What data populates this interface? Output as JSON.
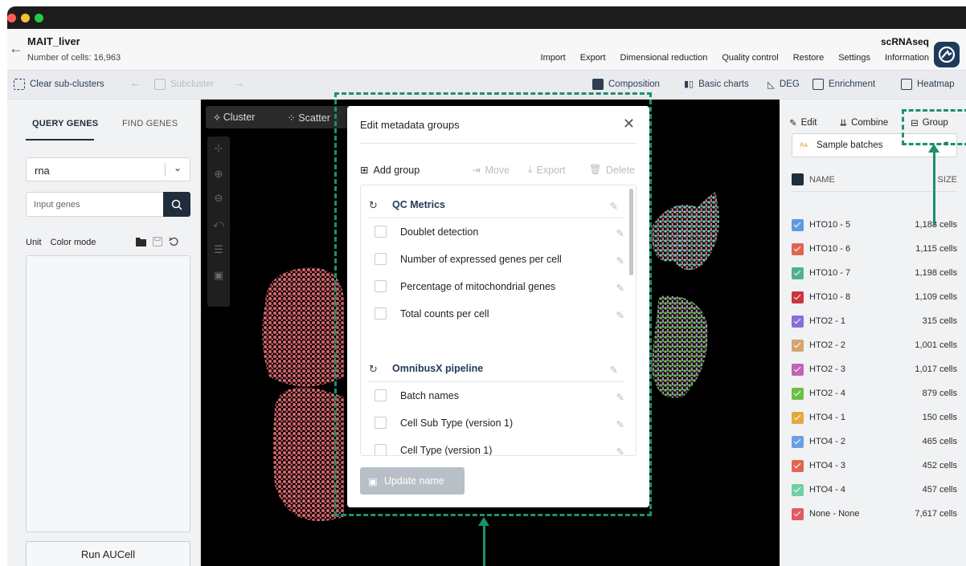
{
  "window": {
    "title": "MAIT_liver",
    "subtitle": "Number of cells: 16,963",
    "app_type": "scRNAseq"
  },
  "menu": [
    "Import",
    "Export",
    "Dimensional reduction",
    "Quality control",
    "Restore",
    "Settings",
    "Information"
  ],
  "toolbar": {
    "clear_subclusters": "Clear sub-clusters",
    "subcluster": "Subcluster",
    "composition": "Composition",
    "basic_charts": "Basic charts",
    "deg": "DEG",
    "enrichment": "Enrichment",
    "heatmap": "Heatmap"
  },
  "left_panel": {
    "tabs": [
      "QUERY GENES",
      "FIND GENES"
    ],
    "assay_select": "rna",
    "gene_input_placeholder": "Input genes",
    "unit_label": "Unit",
    "color_mode_label": "Color mode",
    "run_button": "Run AUCell"
  },
  "plot": {
    "tabs": [
      "Cluster",
      "Scatter"
    ]
  },
  "modal": {
    "title": "Edit metadata groups",
    "actions": {
      "add_group": "Add group",
      "move": "Move",
      "export": "Export",
      "delete": "Delete"
    },
    "groups": [
      {
        "name": "QC Metrics",
        "items": [
          "Doublet detection",
          "Number of expressed genes per cell",
          "Percentage of mitochondrial genes",
          "Total counts per cell"
        ]
      },
      {
        "name": "OmnibusX pipeline",
        "items": [
          "Batch names",
          "Cell Sub Type (version 1)",
          "Cell Type (version 1)"
        ]
      }
    ],
    "update_button": "Update name"
  },
  "right_panel": {
    "actions": {
      "edit": "Edit",
      "combine": "Combine",
      "group": "Group"
    },
    "metadata_select": "Sample batches",
    "columns": {
      "name": "NAME",
      "size": "SIZE"
    },
    "rows": [
      {
        "name": "HTO10 - 5",
        "size": "1,188 cells",
        "color": "#5b9be0"
      },
      {
        "name": "HTO10 - 6",
        "size": "1,115 cells",
        "color": "#e06650"
      },
      {
        "name": "HTO10 - 7",
        "size": "1,198 cells",
        "color": "#52b08e"
      },
      {
        "name": "HTO10 - 8",
        "size": "1,109 cells",
        "color": "#c9363d"
      },
      {
        "name": "HTO2 - 1",
        "size": "315 cells",
        "color": "#8a6fd8"
      },
      {
        "name": "HTO2 - 2",
        "size": "1,001 cells",
        "color": "#d6a46e"
      },
      {
        "name": "HTO2 - 3",
        "size": "1,017 cells",
        "color": "#c262b8"
      },
      {
        "name": "HTO2 - 4",
        "size": "879 cells",
        "color": "#6cbe45"
      },
      {
        "name": "HTO4 - 1",
        "size": "150 cells",
        "color": "#e3a93a"
      },
      {
        "name": "HTO4 - 2",
        "size": "465 cells",
        "color": "#6c9ee6"
      },
      {
        "name": "HTO4 - 3",
        "size": "452 cells",
        "color": "#e06650"
      },
      {
        "name": "HTO4 - 4",
        "size": "457 cells",
        "color": "#6ed0a4"
      },
      {
        "name": "None - None",
        "size": "7,617 cells",
        "color": "#e05a64"
      }
    ]
  },
  "colors": {
    "accent": "#1f2d3c",
    "annotation": "#1f8f6e",
    "group_header": "#233b5a"
  }
}
